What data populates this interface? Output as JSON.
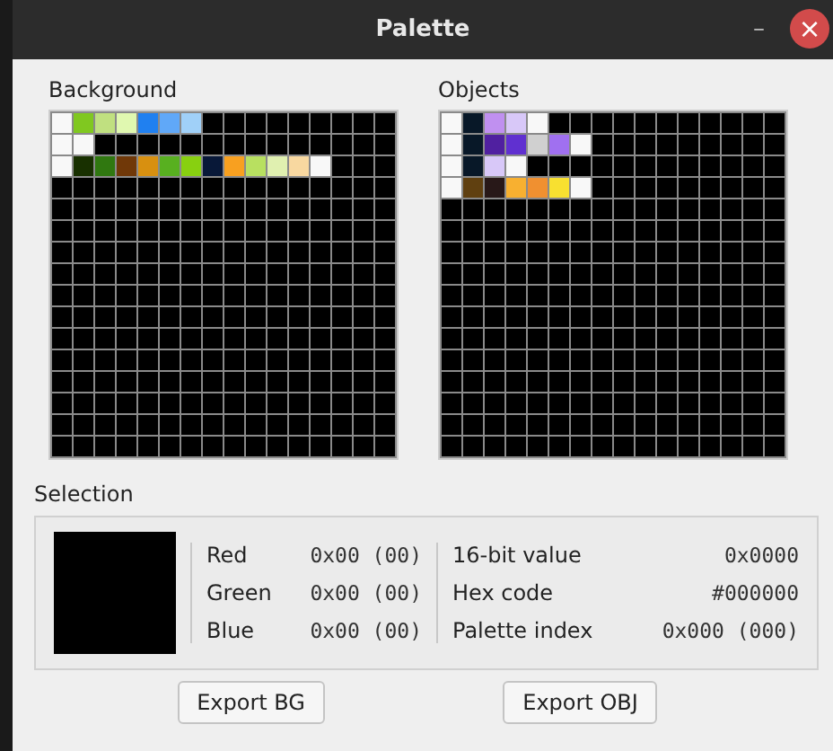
{
  "window": {
    "title": "Palette",
    "minimize": "–",
    "close": "×"
  },
  "palettes": [
    {
      "label": "Background",
      "rows": [
        [
          {
            "color": "#f8f8f8"
          },
          {
            "color": "#80c820"
          },
          {
            "color": "#c0e080"
          },
          {
            "color": "#e0f8b0"
          },
          {
            "color": "#2080f0"
          },
          {
            "color": "#60a8f8"
          },
          {
            "color": "#a0d0f8"
          },
          {
            "color": "#000000"
          },
          {
            "color": "#000000"
          },
          {
            "color": "#000000"
          },
          {
            "color": "#000000"
          },
          {
            "color": "#000000"
          },
          {
            "color": "#000000"
          },
          {
            "color": "#000000"
          },
          {
            "color": "#000000"
          },
          {
            "color": "#000000"
          }
        ],
        [
          {
            "color": "#f8f8f8"
          },
          {
            "color": "#f8f8f8"
          },
          {
            "color": "#000000"
          },
          {
            "color": "#000000"
          },
          {
            "color": "#000000"
          },
          {
            "color": "#000000"
          },
          {
            "color": "#000000"
          },
          {
            "color": "#000000"
          },
          {
            "color": "#000000"
          },
          {
            "color": "#000000"
          },
          {
            "color": "#000000"
          },
          {
            "color": "#000000"
          },
          {
            "color": "#000000"
          },
          {
            "color": "#000000"
          },
          {
            "color": "#000000"
          },
          {
            "color": "#000000"
          }
        ],
        [
          {
            "color": "#f8f8f8"
          },
          {
            "color": "#183000"
          },
          {
            "color": "#307810"
          },
          {
            "color": "#703808"
          },
          {
            "color": "#d89010"
          },
          {
            "color": "#58b020"
          },
          {
            "color": "#88d010"
          },
          {
            "color": "#081838"
          },
          {
            "color": "#f8a020"
          },
          {
            "color": "#b8e060"
          },
          {
            "color": "#e0f0b0"
          },
          {
            "color": "#f8d8a0"
          },
          {
            "color": "#f8f8f8"
          },
          {
            "color": "#000000"
          },
          {
            "color": "#000000"
          },
          {
            "color": "#000000"
          }
        ],
        [
          {
            "color": "#000000"
          },
          {
            "color": "#000000"
          },
          {
            "color": "#000000"
          },
          {
            "color": "#000000"
          },
          {
            "color": "#000000"
          },
          {
            "color": "#000000"
          },
          {
            "color": "#000000"
          },
          {
            "color": "#000000"
          },
          {
            "color": "#000000"
          },
          {
            "color": "#000000"
          },
          {
            "color": "#000000"
          },
          {
            "color": "#000000"
          },
          {
            "color": "#000000"
          },
          {
            "color": "#000000"
          },
          {
            "color": "#000000"
          },
          {
            "color": "#000000"
          }
        ],
        [
          {
            "color": "#000000"
          },
          {
            "color": "#000000"
          },
          {
            "color": "#000000"
          },
          {
            "color": "#000000"
          },
          {
            "color": "#000000"
          },
          {
            "color": "#000000"
          },
          {
            "color": "#000000"
          },
          {
            "color": "#000000"
          },
          {
            "color": "#000000"
          },
          {
            "color": "#000000"
          },
          {
            "color": "#000000"
          },
          {
            "color": "#000000"
          },
          {
            "color": "#000000"
          },
          {
            "color": "#000000"
          },
          {
            "color": "#000000"
          },
          {
            "color": "#000000"
          }
        ],
        [
          {
            "color": "#000000"
          },
          {
            "color": "#000000"
          },
          {
            "color": "#000000"
          },
          {
            "color": "#000000"
          },
          {
            "color": "#000000"
          },
          {
            "color": "#000000"
          },
          {
            "color": "#000000"
          },
          {
            "color": "#000000"
          },
          {
            "color": "#000000"
          },
          {
            "color": "#000000"
          },
          {
            "color": "#000000"
          },
          {
            "color": "#000000"
          },
          {
            "color": "#000000"
          },
          {
            "color": "#000000"
          },
          {
            "color": "#000000"
          },
          {
            "color": "#000000"
          }
        ],
        [
          {
            "color": "#000000"
          },
          {
            "color": "#000000"
          },
          {
            "color": "#000000"
          },
          {
            "color": "#000000"
          },
          {
            "color": "#000000"
          },
          {
            "color": "#000000"
          },
          {
            "color": "#000000"
          },
          {
            "color": "#000000"
          },
          {
            "color": "#000000"
          },
          {
            "color": "#000000"
          },
          {
            "color": "#000000"
          },
          {
            "color": "#000000"
          },
          {
            "color": "#000000"
          },
          {
            "color": "#000000"
          },
          {
            "color": "#000000"
          },
          {
            "color": "#000000"
          }
        ],
        [
          {
            "color": "#000000"
          },
          {
            "color": "#000000"
          },
          {
            "color": "#000000"
          },
          {
            "color": "#000000"
          },
          {
            "color": "#000000"
          },
          {
            "color": "#000000"
          },
          {
            "color": "#000000"
          },
          {
            "color": "#000000"
          },
          {
            "color": "#000000"
          },
          {
            "color": "#000000"
          },
          {
            "color": "#000000"
          },
          {
            "color": "#000000"
          },
          {
            "color": "#000000"
          },
          {
            "color": "#000000"
          },
          {
            "color": "#000000"
          },
          {
            "color": "#000000"
          }
        ],
        [
          {
            "color": "#000000"
          },
          {
            "color": "#000000"
          },
          {
            "color": "#000000"
          },
          {
            "color": "#000000"
          },
          {
            "color": "#000000"
          },
          {
            "color": "#000000"
          },
          {
            "color": "#000000"
          },
          {
            "color": "#000000"
          },
          {
            "color": "#000000"
          },
          {
            "color": "#000000"
          },
          {
            "color": "#000000"
          },
          {
            "color": "#000000"
          },
          {
            "color": "#000000"
          },
          {
            "color": "#000000"
          },
          {
            "color": "#000000"
          },
          {
            "color": "#000000"
          }
        ],
        [
          {
            "color": "#000000"
          },
          {
            "color": "#000000"
          },
          {
            "color": "#000000"
          },
          {
            "color": "#000000"
          },
          {
            "color": "#000000"
          },
          {
            "color": "#000000"
          },
          {
            "color": "#000000"
          },
          {
            "color": "#000000"
          },
          {
            "color": "#000000"
          },
          {
            "color": "#000000"
          },
          {
            "color": "#000000"
          },
          {
            "color": "#000000"
          },
          {
            "color": "#000000"
          },
          {
            "color": "#000000"
          },
          {
            "color": "#000000"
          },
          {
            "color": "#000000"
          }
        ],
        [
          {
            "color": "#000000"
          },
          {
            "color": "#000000"
          },
          {
            "color": "#000000"
          },
          {
            "color": "#000000"
          },
          {
            "color": "#000000"
          },
          {
            "color": "#000000"
          },
          {
            "color": "#000000"
          },
          {
            "color": "#000000"
          },
          {
            "color": "#000000"
          },
          {
            "color": "#000000"
          },
          {
            "color": "#000000"
          },
          {
            "color": "#000000"
          },
          {
            "color": "#000000"
          },
          {
            "color": "#000000"
          },
          {
            "color": "#000000"
          },
          {
            "color": "#000000"
          }
        ],
        [
          {
            "color": "#000000"
          },
          {
            "color": "#000000"
          },
          {
            "color": "#000000"
          },
          {
            "color": "#000000"
          },
          {
            "color": "#000000"
          },
          {
            "color": "#000000"
          },
          {
            "color": "#000000"
          },
          {
            "color": "#000000"
          },
          {
            "color": "#000000"
          },
          {
            "color": "#000000"
          },
          {
            "color": "#000000"
          },
          {
            "color": "#000000"
          },
          {
            "color": "#000000"
          },
          {
            "color": "#000000"
          },
          {
            "color": "#000000"
          },
          {
            "color": "#000000"
          }
        ],
        [
          {
            "color": "#000000"
          },
          {
            "color": "#000000"
          },
          {
            "color": "#000000"
          },
          {
            "color": "#000000"
          },
          {
            "color": "#000000"
          },
          {
            "color": "#000000"
          },
          {
            "color": "#000000"
          },
          {
            "color": "#000000"
          },
          {
            "color": "#000000"
          },
          {
            "color": "#000000"
          },
          {
            "color": "#000000"
          },
          {
            "color": "#000000"
          },
          {
            "color": "#000000"
          },
          {
            "color": "#000000"
          },
          {
            "color": "#000000"
          },
          {
            "color": "#000000"
          }
        ],
        [
          {
            "color": "#000000"
          },
          {
            "color": "#000000"
          },
          {
            "color": "#000000"
          },
          {
            "color": "#000000"
          },
          {
            "color": "#000000"
          },
          {
            "color": "#000000"
          },
          {
            "color": "#000000"
          },
          {
            "color": "#000000"
          },
          {
            "color": "#000000"
          },
          {
            "color": "#000000"
          },
          {
            "color": "#000000"
          },
          {
            "color": "#000000"
          },
          {
            "color": "#000000"
          },
          {
            "color": "#000000"
          },
          {
            "color": "#000000"
          },
          {
            "color": "#000000"
          }
        ],
        [
          {
            "color": "#000000"
          },
          {
            "color": "#000000"
          },
          {
            "color": "#000000"
          },
          {
            "color": "#000000"
          },
          {
            "color": "#000000"
          },
          {
            "color": "#000000"
          },
          {
            "color": "#000000"
          },
          {
            "color": "#000000"
          },
          {
            "color": "#000000"
          },
          {
            "color": "#000000"
          },
          {
            "color": "#000000"
          },
          {
            "color": "#000000"
          },
          {
            "color": "#000000"
          },
          {
            "color": "#000000"
          },
          {
            "color": "#000000"
          },
          {
            "color": "#000000"
          }
        ],
        [
          {
            "color": "#000000"
          },
          {
            "color": "#000000"
          },
          {
            "color": "#000000"
          },
          {
            "color": "#000000"
          },
          {
            "color": "#000000"
          },
          {
            "color": "#000000"
          },
          {
            "color": "#000000"
          },
          {
            "color": "#000000"
          },
          {
            "color": "#000000"
          },
          {
            "color": "#000000"
          },
          {
            "color": "#000000"
          },
          {
            "color": "#000000"
          },
          {
            "color": "#000000"
          },
          {
            "color": "#000000"
          },
          {
            "color": "#000000"
          },
          {
            "color": "#000000"
          }
        ]
      ]
    },
    {
      "label": "Objects",
      "rows": [
        [
          {
            "color": "#f8f8f8"
          },
          {
            "color": "#081828"
          },
          {
            "color": "#c090f0"
          },
          {
            "color": "#d8c8f8"
          },
          {
            "color": "#f8f8f8"
          },
          {
            "color": "#000000"
          },
          {
            "color": "#000000"
          },
          {
            "color": "#000000"
          },
          {
            "color": "#000000"
          },
          {
            "color": "#000000"
          },
          {
            "color": "#000000"
          },
          {
            "color": "#000000"
          },
          {
            "color": "#000000"
          },
          {
            "color": "#000000"
          },
          {
            "color": "#000000"
          },
          {
            "color": "#000000"
          }
        ],
        [
          {
            "color": "#f8f8f8"
          },
          {
            "color": "#081828"
          },
          {
            "color": "#5020a0"
          },
          {
            "color": "#6030d0"
          },
          {
            "color": "#d0d0d0"
          },
          {
            "color": "#a070f0"
          },
          {
            "color": "#f8f8f8"
          },
          {
            "color": "#000000"
          },
          {
            "color": "#000000"
          },
          {
            "color": "#000000"
          },
          {
            "color": "#000000"
          },
          {
            "color": "#000000"
          },
          {
            "color": "#000000"
          },
          {
            "color": "#000000"
          },
          {
            "color": "#000000"
          },
          {
            "color": "#000000"
          }
        ],
        [
          {
            "color": "#f8f8f8"
          },
          {
            "color": "#081828"
          },
          {
            "color": "#d8c8f8"
          },
          {
            "color": "#f8f8f8"
          },
          {
            "color": "#000000"
          },
          {
            "color": "#000000"
          },
          {
            "color": "#000000"
          },
          {
            "color": "#000000"
          },
          {
            "color": "#000000"
          },
          {
            "color": "#000000"
          },
          {
            "color": "#000000"
          },
          {
            "color": "#000000"
          },
          {
            "color": "#000000"
          },
          {
            "color": "#000000"
          },
          {
            "color": "#000000"
          },
          {
            "color": "#000000"
          }
        ],
        [
          {
            "color": "#f8f8f8"
          },
          {
            "color": "#604010"
          },
          {
            "color": "#281818"
          },
          {
            "color": "#f8b030"
          },
          {
            "color": "#f09030"
          },
          {
            "color": "#f8e030"
          },
          {
            "color": "#f8f8f8"
          },
          {
            "color": "#000000"
          },
          {
            "color": "#000000"
          },
          {
            "color": "#000000"
          },
          {
            "color": "#000000"
          },
          {
            "color": "#000000"
          },
          {
            "color": "#000000"
          },
          {
            "color": "#000000"
          },
          {
            "color": "#000000"
          },
          {
            "color": "#000000"
          }
        ],
        [
          {
            "color": "#000000"
          },
          {
            "color": "#000000"
          },
          {
            "color": "#000000"
          },
          {
            "color": "#000000"
          },
          {
            "color": "#000000"
          },
          {
            "color": "#000000"
          },
          {
            "color": "#000000"
          },
          {
            "color": "#000000"
          },
          {
            "color": "#000000"
          },
          {
            "color": "#000000"
          },
          {
            "color": "#000000"
          },
          {
            "color": "#000000"
          },
          {
            "color": "#000000"
          },
          {
            "color": "#000000"
          },
          {
            "color": "#000000"
          },
          {
            "color": "#000000"
          }
        ],
        [
          {
            "color": "#000000"
          },
          {
            "color": "#000000"
          },
          {
            "color": "#000000"
          },
          {
            "color": "#000000"
          },
          {
            "color": "#000000"
          },
          {
            "color": "#000000"
          },
          {
            "color": "#000000"
          },
          {
            "color": "#000000"
          },
          {
            "color": "#000000"
          },
          {
            "color": "#000000"
          },
          {
            "color": "#000000"
          },
          {
            "color": "#000000"
          },
          {
            "color": "#000000"
          },
          {
            "color": "#000000"
          },
          {
            "color": "#000000"
          },
          {
            "color": "#000000"
          }
        ],
        [
          {
            "color": "#000000"
          },
          {
            "color": "#000000"
          },
          {
            "color": "#000000"
          },
          {
            "color": "#000000"
          },
          {
            "color": "#000000"
          },
          {
            "color": "#000000"
          },
          {
            "color": "#000000"
          },
          {
            "color": "#000000"
          },
          {
            "color": "#000000"
          },
          {
            "color": "#000000"
          },
          {
            "color": "#000000"
          },
          {
            "color": "#000000"
          },
          {
            "color": "#000000"
          },
          {
            "color": "#000000"
          },
          {
            "color": "#000000"
          },
          {
            "color": "#000000"
          }
        ],
        [
          {
            "color": "#000000"
          },
          {
            "color": "#000000"
          },
          {
            "color": "#000000"
          },
          {
            "color": "#000000"
          },
          {
            "color": "#000000"
          },
          {
            "color": "#000000"
          },
          {
            "color": "#000000"
          },
          {
            "color": "#000000"
          },
          {
            "color": "#000000"
          },
          {
            "color": "#000000"
          },
          {
            "color": "#000000"
          },
          {
            "color": "#000000"
          },
          {
            "color": "#000000"
          },
          {
            "color": "#000000"
          },
          {
            "color": "#000000"
          },
          {
            "color": "#000000"
          }
        ],
        [
          {
            "color": "#000000"
          },
          {
            "color": "#000000"
          },
          {
            "color": "#000000"
          },
          {
            "color": "#000000"
          },
          {
            "color": "#000000"
          },
          {
            "color": "#000000"
          },
          {
            "color": "#000000"
          },
          {
            "color": "#000000"
          },
          {
            "color": "#000000"
          },
          {
            "color": "#000000"
          },
          {
            "color": "#000000"
          },
          {
            "color": "#000000"
          },
          {
            "color": "#000000"
          },
          {
            "color": "#000000"
          },
          {
            "color": "#000000"
          },
          {
            "color": "#000000"
          }
        ],
        [
          {
            "color": "#000000"
          },
          {
            "color": "#000000"
          },
          {
            "color": "#000000"
          },
          {
            "color": "#000000"
          },
          {
            "color": "#000000"
          },
          {
            "color": "#000000"
          },
          {
            "color": "#000000"
          },
          {
            "color": "#000000"
          },
          {
            "color": "#000000"
          },
          {
            "color": "#000000"
          },
          {
            "color": "#000000"
          },
          {
            "color": "#000000"
          },
          {
            "color": "#000000"
          },
          {
            "color": "#000000"
          },
          {
            "color": "#000000"
          },
          {
            "color": "#000000"
          }
        ],
        [
          {
            "color": "#000000"
          },
          {
            "color": "#000000"
          },
          {
            "color": "#000000"
          },
          {
            "color": "#000000"
          },
          {
            "color": "#000000"
          },
          {
            "color": "#000000"
          },
          {
            "color": "#000000"
          },
          {
            "color": "#000000"
          },
          {
            "color": "#000000"
          },
          {
            "color": "#000000"
          },
          {
            "color": "#000000"
          },
          {
            "color": "#000000"
          },
          {
            "color": "#000000"
          },
          {
            "color": "#000000"
          },
          {
            "color": "#000000"
          },
          {
            "color": "#000000"
          }
        ],
        [
          {
            "color": "#000000"
          },
          {
            "color": "#000000"
          },
          {
            "color": "#000000"
          },
          {
            "color": "#000000"
          },
          {
            "color": "#000000"
          },
          {
            "color": "#000000"
          },
          {
            "color": "#000000"
          },
          {
            "color": "#000000"
          },
          {
            "color": "#000000"
          },
          {
            "color": "#000000"
          },
          {
            "color": "#000000"
          },
          {
            "color": "#000000"
          },
          {
            "color": "#000000"
          },
          {
            "color": "#000000"
          },
          {
            "color": "#000000"
          },
          {
            "color": "#000000"
          }
        ],
        [
          {
            "color": "#000000"
          },
          {
            "color": "#000000"
          },
          {
            "color": "#000000"
          },
          {
            "color": "#000000"
          },
          {
            "color": "#000000"
          },
          {
            "color": "#000000"
          },
          {
            "color": "#000000"
          },
          {
            "color": "#000000"
          },
          {
            "color": "#000000"
          },
          {
            "color": "#000000"
          },
          {
            "color": "#000000"
          },
          {
            "color": "#000000"
          },
          {
            "color": "#000000"
          },
          {
            "color": "#000000"
          },
          {
            "color": "#000000"
          },
          {
            "color": "#000000"
          }
        ],
        [
          {
            "color": "#000000"
          },
          {
            "color": "#000000"
          },
          {
            "color": "#000000"
          },
          {
            "color": "#000000"
          },
          {
            "color": "#000000"
          },
          {
            "color": "#000000"
          },
          {
            "color": "#000000"
          },
          {
            "color": "#000000"
          },
          {
            "color": "#000000"
          },
          {
            "color": "#000000"
          },
          {
            "color": "#000000"
          },
          {
            "color": "#000000"
          },
          {
            "color": "#000000"
          },
          {
            "color": "#000000"
          },
          {
            "color": "#000000"
          },
          {
            "color": "#000000"
          }
        ],
        [
          {
            "color": "#000000"
          },
          {
            "color": "#000000"
          },
          {
            "color": "#000000"
          },
          {
            "color": "#000000"
          },
          {
            "color": "#000000"
          },
          {
            "color": "#000000"
          },
          {
            "color": "#000000"
          },
          {
            "color": "#000000"
          },
          {
            "color": "#000000"
          },
          {
            "color": "#000000"
          },
          {
            "color": "#000000"
          },
          {
            "color": "#000000"
          },
          {
            "color": "#000000"
          },
          {
            "color": "#000000"
          },
          {
            "color": "#000000"
          },
          {
            "color": "#000000"
          }
        ],
        [
          {
            "color": "#000000"
          },
          {
            "color": "#000000"
          },
          {
            "color": "#000000"
          },
          {
            "color": "#000000"
          },
          {
            "color": "#000000"
          },
          {
            "color": "#000000"
          },
          {
            "color": "#000000"
          },
          {
            "color": "#000000"
          },
          {
            "color": "#000000"
          },
          {
            "color": "#000000"
          },
          {
            "color": "#000000"
          },
          {
            "color": "#000000"
          },
          {
            "color": "#000000"
          },
          {
            "color": "#000000"
          },
          {
            "color": "#000000"
          },
          {
            "color": "#000000"
          }
        ]
      ]
    }
  ],
  "selection": {
    "label": "Selection",
    "color": "#000000",
    "channels": [
      {
        "name": "Red",
        "value": "0x00 (00)"
      },
      {
        "name": "Green",
        "value": "0x00 (00)"
      },
      {
        "name": "Blue",
        "value": "0x00 (00)"
      }
    ],
    "details": [
      {
        "name": "16-bit value",
        "value": "0x0000"
      },
      {
        "name": "Hex code",
        "value": "#000000"
      },
      {
        "name": "Palette index",
        "value": "0x000 (000)"
      }
    ]
  },
  "buttons": [
    "Export BG",
    "Export OBJ"
  ]
}
